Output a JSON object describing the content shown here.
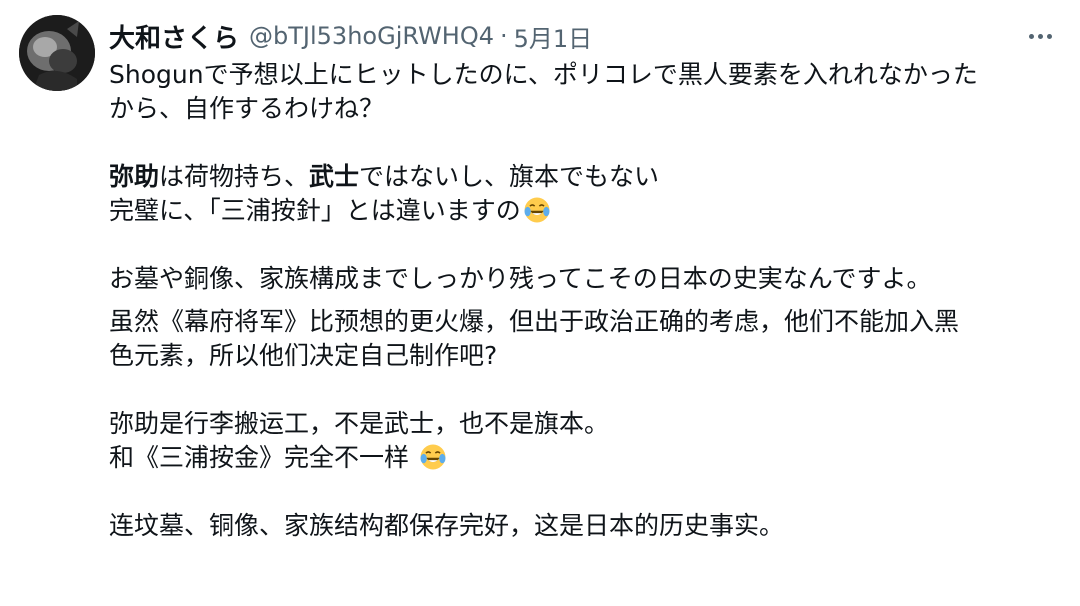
{
  "tweet": {
    "display_name": "大和さくら",
    "handle": "@bTJl53hoGjRWHQ4",
    "separator": "·",
    "date": "5月1日",
    "more_label": "…",
    "jp": {
      "line1": "Shogunで予想以上にヒットしたのに、ポリコレで黒人要素を入れれなかった",
      "line2": "から、自作するわけね？",
      "line3_a": "弥助",
      "line3_b": "は荷物持ち、",
      "line3_c": "武士",
      "line3_d": "ではないし、旗本でもない",
      "line4": "完璧に、「三浦按針」とは違いますの",
      "line5": "お墓や銅像、家族構成までしっかり残ってこその日本の史実なんですよ。"
    },
    "zh": {
      "line1": "虽然《幕府将军》比预想的更火爆，但出于政治正确的考虑，他们不能加入黑",
      "line2": "色元素，所以他们决定自己制作吧?",
      "line3": "弥助是行李搬运工，不是武士，也不是旗本。",
      "line4": "和《三浦按金》完全不一样 ",
      "line5": "连坟墓、铜像、家族结构都保存完好，这是日本的历史事实。"
    },
    "emoji_name": "face-with-tears-of-joy-icon"
  }
}
